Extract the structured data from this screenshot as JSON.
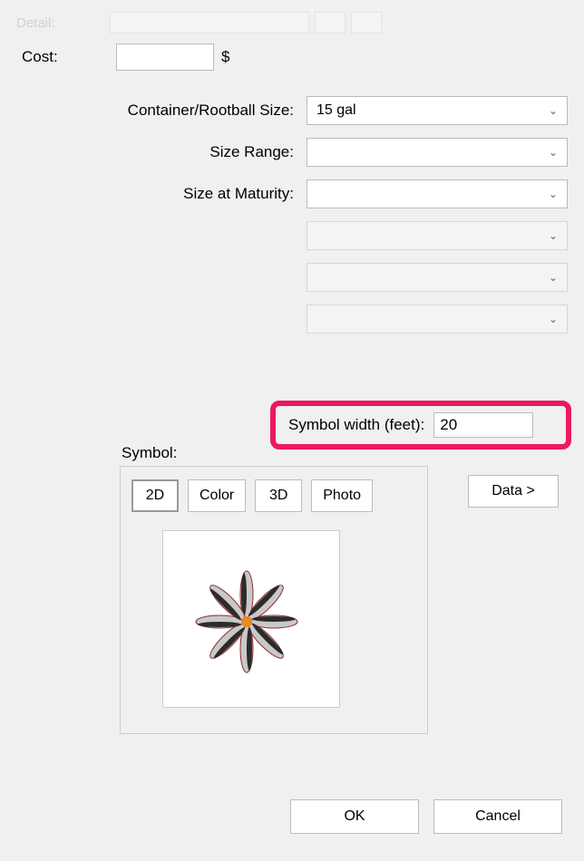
{
  "detail": {
    "label_faded": "Detail:"
  },
  "cost": {
    "label": "Cost:",
    "value": "",
    "currency": "$"
  },
  "fields": {
    "container": {
      "label": "Container/Rootball Size:",
      "value": "15 gal"
    },
    "size_range": {
      "label": "Size Range:",
      "value": ""
    },
    "size_maturity": {
      "label": "Size at Maturity:",
      "value": ""
    },
    "extra1": {
      "value": ""
    },
    "extra2": {
      "value": ""
    },
    "extra3": {
      "value": ""
    }
  },
  "symbol_width": {
    "label": "Symbol width (feet):",
    "value": "20"
  },
  "symbol": {
    "title": "Symbol:",
    "tabs": {
      "t2d": "2D",
      "color": "Color",
      "t3d": "3D",
      "photo": "Photo"
    }
  },
  "buttons": {
    "data": "Data >",
    "ok": "OK",
    "cancel": "Cancel"
  }
}
